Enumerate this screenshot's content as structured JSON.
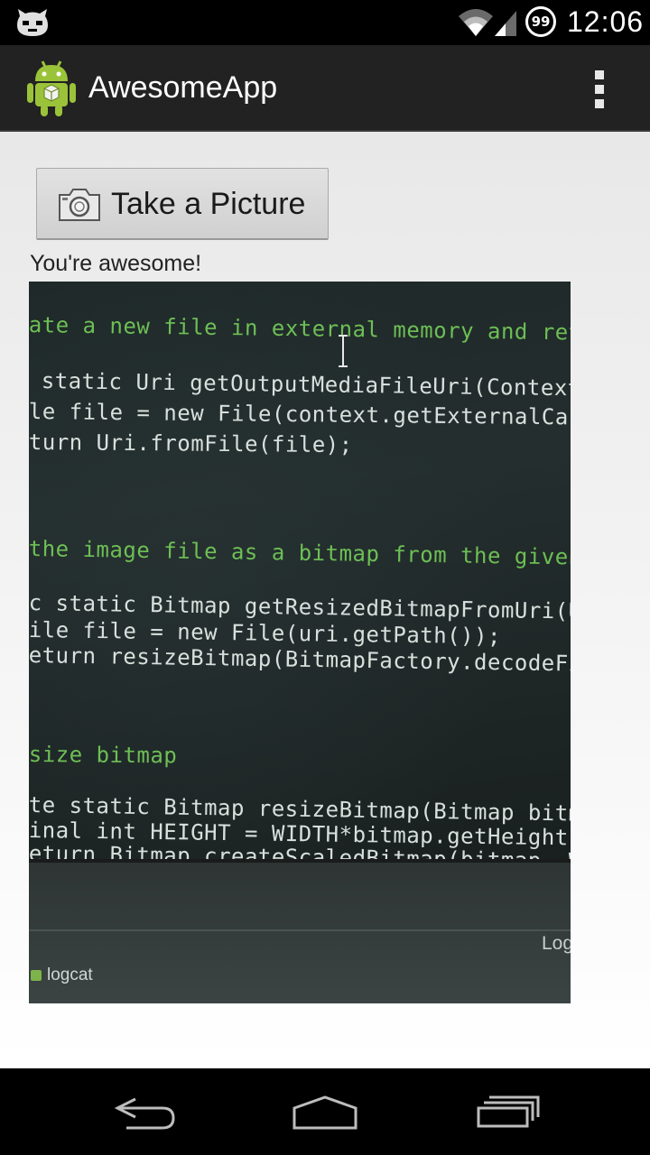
{
  "status_bar": {
    "time": "12:06",
    "battery": "99"
  },
  "action_bar": {
    "title": "AwesomeApp"
  },
  "content": {
    "take_picture_label": "Take a Picture",
    "message": "You're awesome!"
  },
  "photo": {
    "code_lines": [
      "ate a new file in external memory and retu",
      "static Uri getOutputMediaFileUri(Context",
      "le file = new File(context.getExternalCach",
      "turn Uri.fromFile(file);",
      "the image file as a bitmap from the given",
      "c static Bitmap getResizedBitmapFromUri(Uri",
      "ile file = new File(uri.getPath());",
      "eturn resizeBitmap(BitmapFactory.decodeFile(f",
      "size bitmap",
      "te static Bitmap resizeBitmap(Bitmap bitmap) {",
      "inal int HEIGHT = WIDTH*bitmap.getHeight()/bit",
      "eturn Bitmap.createScaledBitmap(bitmap, WIDTH,"
    ],
    "log_tab": "Log",
    "logcat_label": "logcat"
  }
}
